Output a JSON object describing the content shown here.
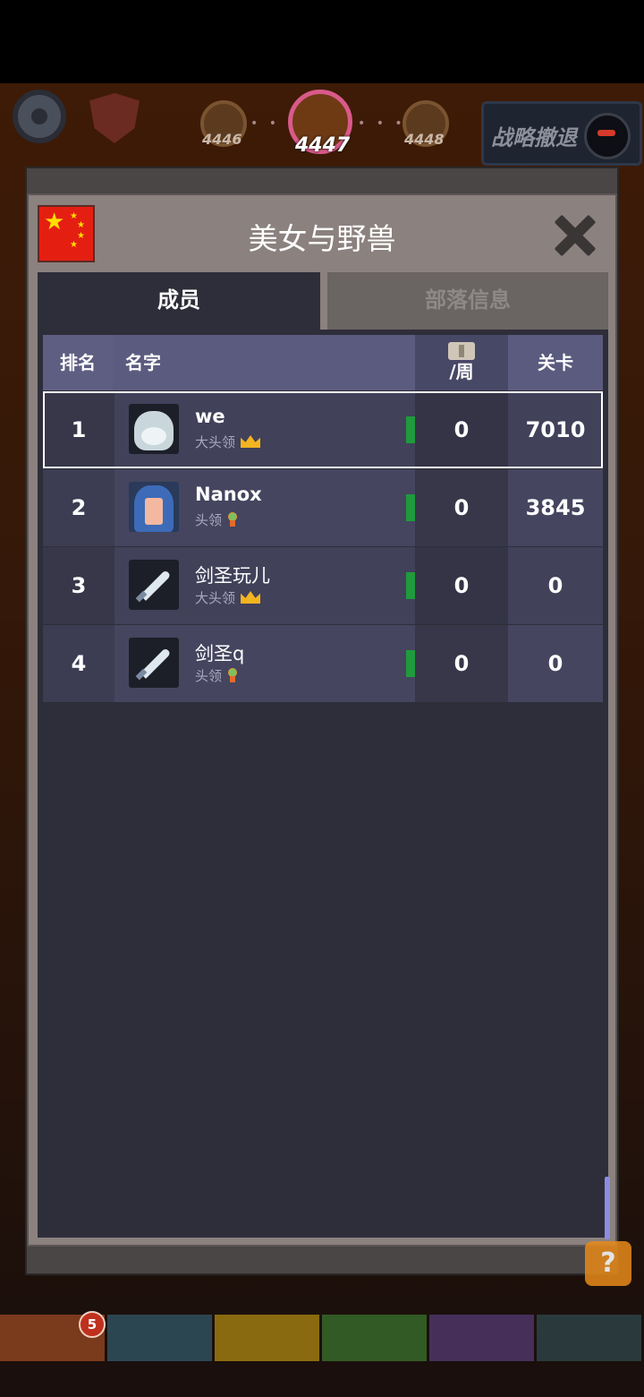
{
  "background": {
    "levels": [
      "4446",
      "4447",
      "4448"
    ],
    "retreat_label": "战略撤退",
    "help_label": "?",
    "bottom_badge": "5",
    "colors": {
      "accent_help": "#e78a1a",
      "badge": "#c0301e"
    }
  },
  "dialog": {
    "title": "美女与野兽",
    "close_icon": "close-x-icon",
    "flag": "china-flag",
    "tabs": [
      {
        "label": "成员",
        "active": true
      },
      {
        "label": "部落信息",
        "active": false
      }
    ],
    "table": {
      "headers": {
        "rank": "排名",
        "name": "名字",
        "contrib": "/周",
        "stage": "关卡"
      },
      "rows": [
        {
          "rank": "1",
          "name": "we",
          "role": "大头领",
          "role_icon": "crown-icon",
          "avatar": "yeti-avatar",
          "flag": "italy-flag",
          "contrib": "0",
          "stage": "7010",
          "selected": true
        },
        {
          "rank": "2",
          "name": "Nanox",
          "role": "头领",
          "role_icon": "medal-icon",
          "avatar": "hooded-avatar",
          "flag": "italy-flag",
          "contrib": "0",
          "stage": "3845",
          "selected": false
        },
        {
          "rank": "3",
          "name": "剑圣玩儿",
          "role": "大头领",
          "role_icon": "crown-icon",
          "avatar": "sword-avatar",
          "flag": "italy-flag",
          "contrib": "0",
          "stage": "0",
          "selected": false
        },
        {
          "rank": "4",
          "name": "剑圣q",
          "role": "头领",
          "role_icon": "medal-icon",
          "avatar": "sword-avatar",
          "flag": "italy-flag",
          "contrib": "0",
          "stage": "0",
          "selected": false
        }
      ]
    }
  }
}
